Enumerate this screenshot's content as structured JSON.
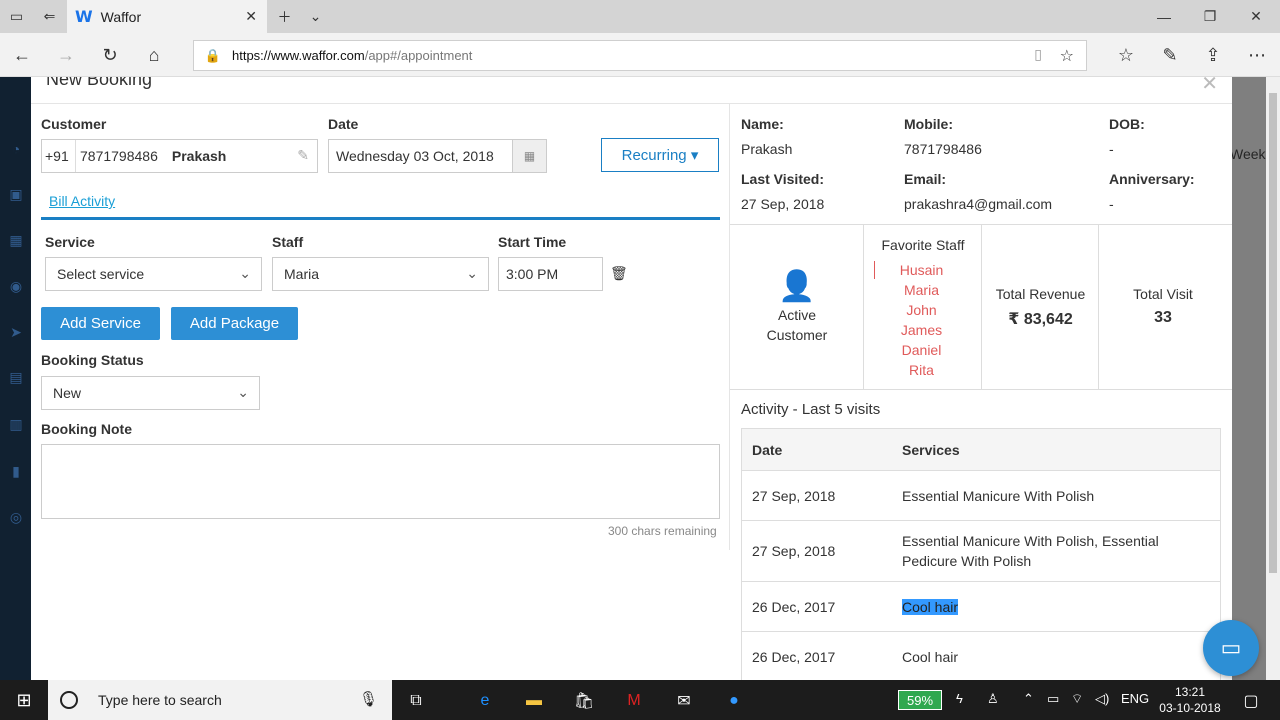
{
  "browser": {
    "tab_title": "Waffor",
    "favicon": "W",
    "url_host": "https://www.waffor.com",
    "url_path": "/app#/appointment"
  },
  "background": {
    "week_label": "Week"
  },
  "modal": {
    "title": "New Booking",
    "customer_label": "Customer",
    "country_code": "+91",
    "phone": "7871798486",
    "customer_name": "Prakash",
    "date_label": "Date",
    "date_value": "Wednesday 03 Oct, 2018",
    "recurring_label": "Recurring ▾",
    "bill_activity": "Bill Activity",
    "service_label": "Service",
    "service_value": "Select service",
    "staff_label": "Staff",
    "staff_value": "Maria",
    "start_time_label": "Start Time",
    "start_time_value": "3:00 PM",
    "add_service": "Add Service",
    "add_package": "Add Package",
    "booking_status_label": "Booking Status",
    "booking_status_value": "New",
    "booking_note_label": "Booking Note",
    "chars_remaining": "300 chars remaining"
  },
  "customer_info": {
    "name_label": "Name:",
    "name": "Prakash",
    "mobile_label": "Mobile:",
    "mobile": "7871798486",
    "dob_label": "DOB:",
    "dob": "-",
    "last_visited_label": "Last Visited:",
    "last_visited": "27 Sep, 2018",
    "email_label": "Email:",
    "email": "prakashra4@gmail.com",
    "anniversary_label": "Anniversary:",
    "anniversary": "-"
  },
  "stats": {
    "active_line1": "Active",
    "active_line2": "Customer",
    "favorite_staff_label": "Favorite Staff",
    "favorite_staff": [
      "Husain",
      "Maria",
      "John",
      "James",
      "Daniel",
      "Rita"
    ],
    "total_revenue_label": "Total Revenue",
    "total_revenue": "₹ 83,642",
    "total_visit_label": "Total Visit",
    "total_visit": "33"
  },
  "activity": {
    "title": "Activity - Last 5 visits",
    "headers": [
      "Date",
      "Services"
    ],
    "rows": [
      {
        "date": "27 Sep, 2018",
        "services": "Essential Manicure With Polish"
      },
      {
        "date": "27 Sep, 2018",
        "services": "Essential Manicure With Polish, Essential Pedicure With Polish"
      },
      {
        "date": "26 Dec, 2017",
        "services": "Cool hair"
      },
      {
        "date": "26 Dec, 2017",
        "services": "Cool hair"
      }
    ]
  },
  "taskbar": {
    "search_placeholder": "Type here to search",
    "battery": "59%",
    "language": "ENG",
    "time": "13:21",
    "date": "03-10-2018"
  },
  "colors": {
    "accent": "#2d8fd5",
    "link": "#1a9fd6",
    "favorite": "#e05a5a",
    "active_green": "#2fa84f"
  }
}
